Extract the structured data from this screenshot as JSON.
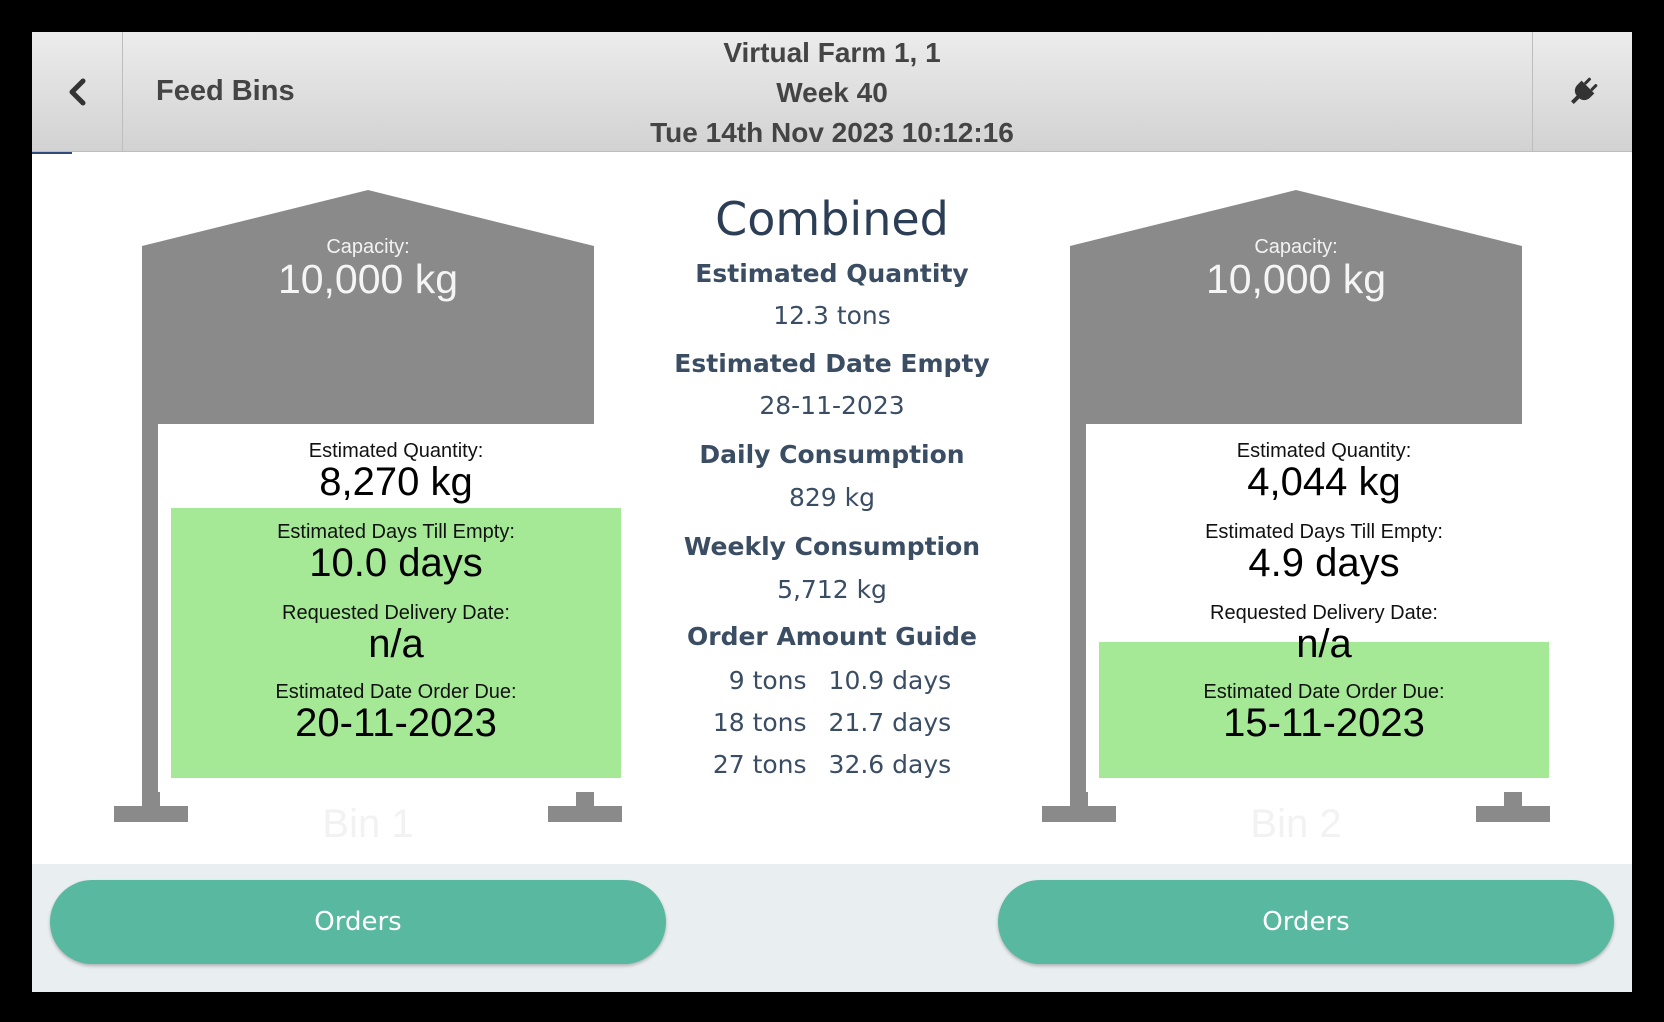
{
  "header": {
    "title": "Feed Bins",
    "farm": "Virtual Farm 1, 1",
    "week": "Week 40",
    "datetime": "Tue 14th Nov 2023 10:12:16",
    "back_icon": "chevron-left-icon",
    "plug_icon": "plug-icon"
  },
  "colors": {
    "bin_gray": "#8a8a8a",
    "highlight_green": "#a5e895",
    "button_teal": "#58b8a0",
    "text_navy": "#2c3e55"
  },
  "bins": [
    {
      "name": "Bin 1",
      "capacity_label": "Capacity:",
      "capacity": "10,000 kg",
      "quantity_label": "Estimated Quantity:",
      "quantity": "8,270 kg",
      "days_label": "Estimated Days Till Empty:",
      "days": "10.0 days",
      "delivery_label": "Requested Delivery Date:",
      "delivery": "n/a",
      "order_due_label": "Estimated Date Order Due:",
      "order_due": "20-11-2023",
      "orders_button": "Orders"
    },
    {
      "name": "Bin 2",
      "capacity_label": "Capacity:",
      "capacity": "10,000 kg",
      "quantity_label": "Estimated Quantity:",
      "quantity": "4,044 kg",
      "days_label": "Estimated Days Till Empty:",
      "days": "4.9 days",
      "delivery_label": "Requested Delivery Date:",
      "delivery": "n/a",
      "order_due_label": "Estimated Date Order Due:",
      "order_due": "15-11-2023",
      "orders_button": "Orders"
    }
  ],
  "combined": {
    "title": "Combined",
    "quantity_label": "Estimated Quantity",
    "quantity": "12.3 tons",
    "date_empty_label": "Estimated Date Empty",
    "date_empty": "28-11-2023",
    "daily_label": "Daily Consumption",
    "daily": "829 kg",
    "weekly_label": "Weekly Consumption",
    "weekly": "5,712 kg",
    "guide_label": "Order Amount Guide",
    "guide": [
      {
        "tons": "9 tons",
        "days": "10.9 days"
      },
      {
        "tons": "18 tons",
        "days": "21.7 days"
      },
      {
        "tons": "27 tons",
        "days": "32.6 days"
      }
    ]
  }
}
